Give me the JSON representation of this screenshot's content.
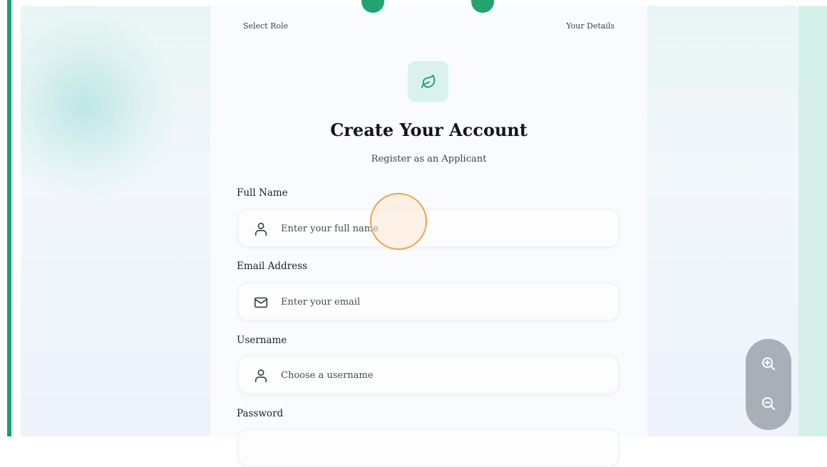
{
  "steps": {
    "step1_label": "Select Role",
    "step2_label": "Your Details",
    "active_color": "#22a36f"
  },
  "form": {
    "logo_icon": "leaf-icon",
    "title": "Create Your Account",
    "subtitle": "Register as an Applicant",
    "fields": [
      {
        "label": "Full Name",
        "placeholder": "Enter your full name",
        "value": "",
        "icon": "user-icon"
      },
      {
        "label": "Email Address",
        "placeholder": "Enter your email",
        "value": "",
        "icon": "mail-icon"
      },
      {
        "label": "Username",
        "placeholder": "Choose a username",
        "value": "",
        "icon": "user-icon"
      },
      {
        "label": "Password",
        "placeholder": "",
        "value": "",
        "icon": ""
      }
    ]
  },
  "zoom": {
    "in_icon": "zoom-in-icon",
    "out_icon": "zoom-out-icon"
  },
  "colors": {
    "accent": "#1a9e6c",
    "logo_bg": "#d9f3ec",
    "cursor_ring": "#f0a24c"
  }
}
